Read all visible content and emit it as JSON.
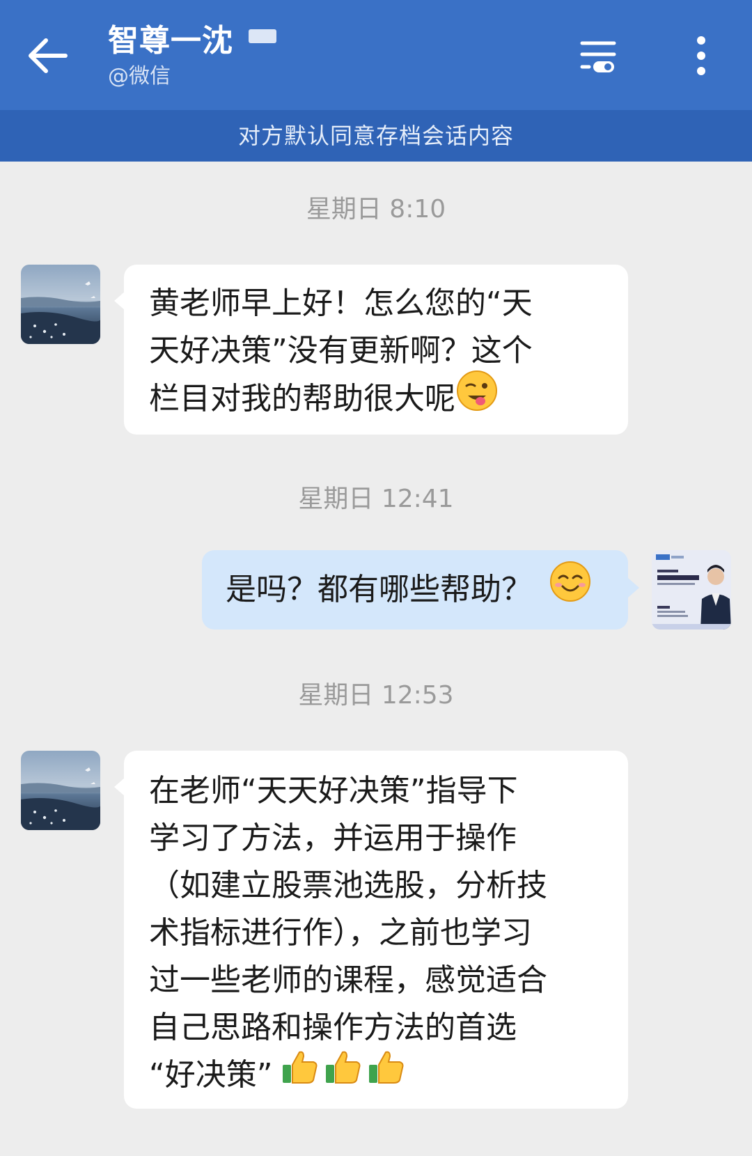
{
  "header": {
    "title": "智尊一沈",
    "subtitle": "@微信",
    "icons": {
      "back": "arrow-left-icon",
      "filter": "filter-toggle-icon",
      "more": "more-vertical-icon"
    },
    "colors": {
      "header_bg": "#3A71C6",
      "notice_bg": "#2F63B6"
    }
  },
  "notice": {
    "text": "对方默认同意存档会话内容"
  },
  "messages": [
    {
      "timestamp": "星期日   8:10",
      "side": "left",
      "lines": [
        "黄老师早上好！怎么您的“天",
        "天好决策”没有更新啊？这个",
        "栏目对我的帮助很大呢"
      ],
      "emoji": "winking-tongue-emoji"
    },
    {
      "timestamp": "星期日   12:41",
      "side": "right",
      "lines": [
        "是吗？都有哪些帮助？"
      ],
      "emoji": "smiling-face-emoji",
      "avatar_card": {
        "headline": "21年复盘",
        "subline": "让投资遇见美好"
      }
    },
    {
      "timestamp": "星期日   12:53",
      "side": "left",
      "lines": [
        "在老师“天天好决策”指导下",
        "学习了方法，并运用于操作",
        "（如建立股票池选股，分析技",
        "术指标进行作），之前也学习",
        "过一些老师的课程，感觉适合",
        "自己思路和操作方法的首选",
        "“好决策”"
      ],
      "emoji": "thumbs-up-icon-x3"
    }
  ]
}
